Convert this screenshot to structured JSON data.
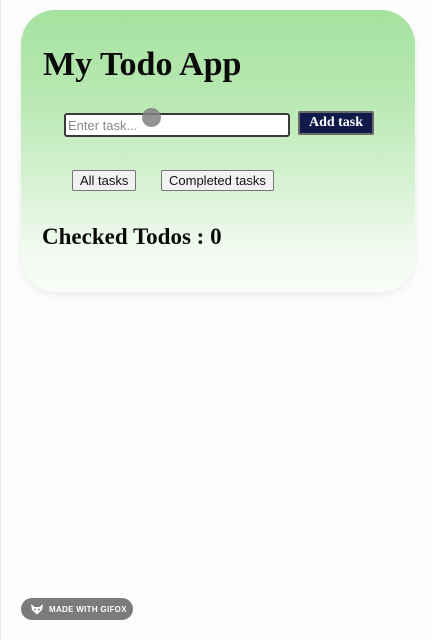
{
  "app": {
    "title": "My Todo App"
  },
  "task_input": {
    "placeholder": "Enter task...",
    "value": ""
  },
  "add_button": {
    "label": "Add task"
  },
  "filters": [
    {
      "label": "All tasks"
    },
    {
      "label": "Completed tasks"
    }
  ],
  "checked": {
    "text": "Checked Todos : 0"
  },
  "watermark": {
    "text": "MADE WITH GIFOX",
    "icon": "fox-icon"
  },
  "colors": {
    "card_gradient_top": "#a6e2a0",
    "card_gradient_bottom": "#f9fcf8",
    "add_button_bg": "#0f1a4a",
    "watermark_bg": "#7b7b7b"
  }
}
